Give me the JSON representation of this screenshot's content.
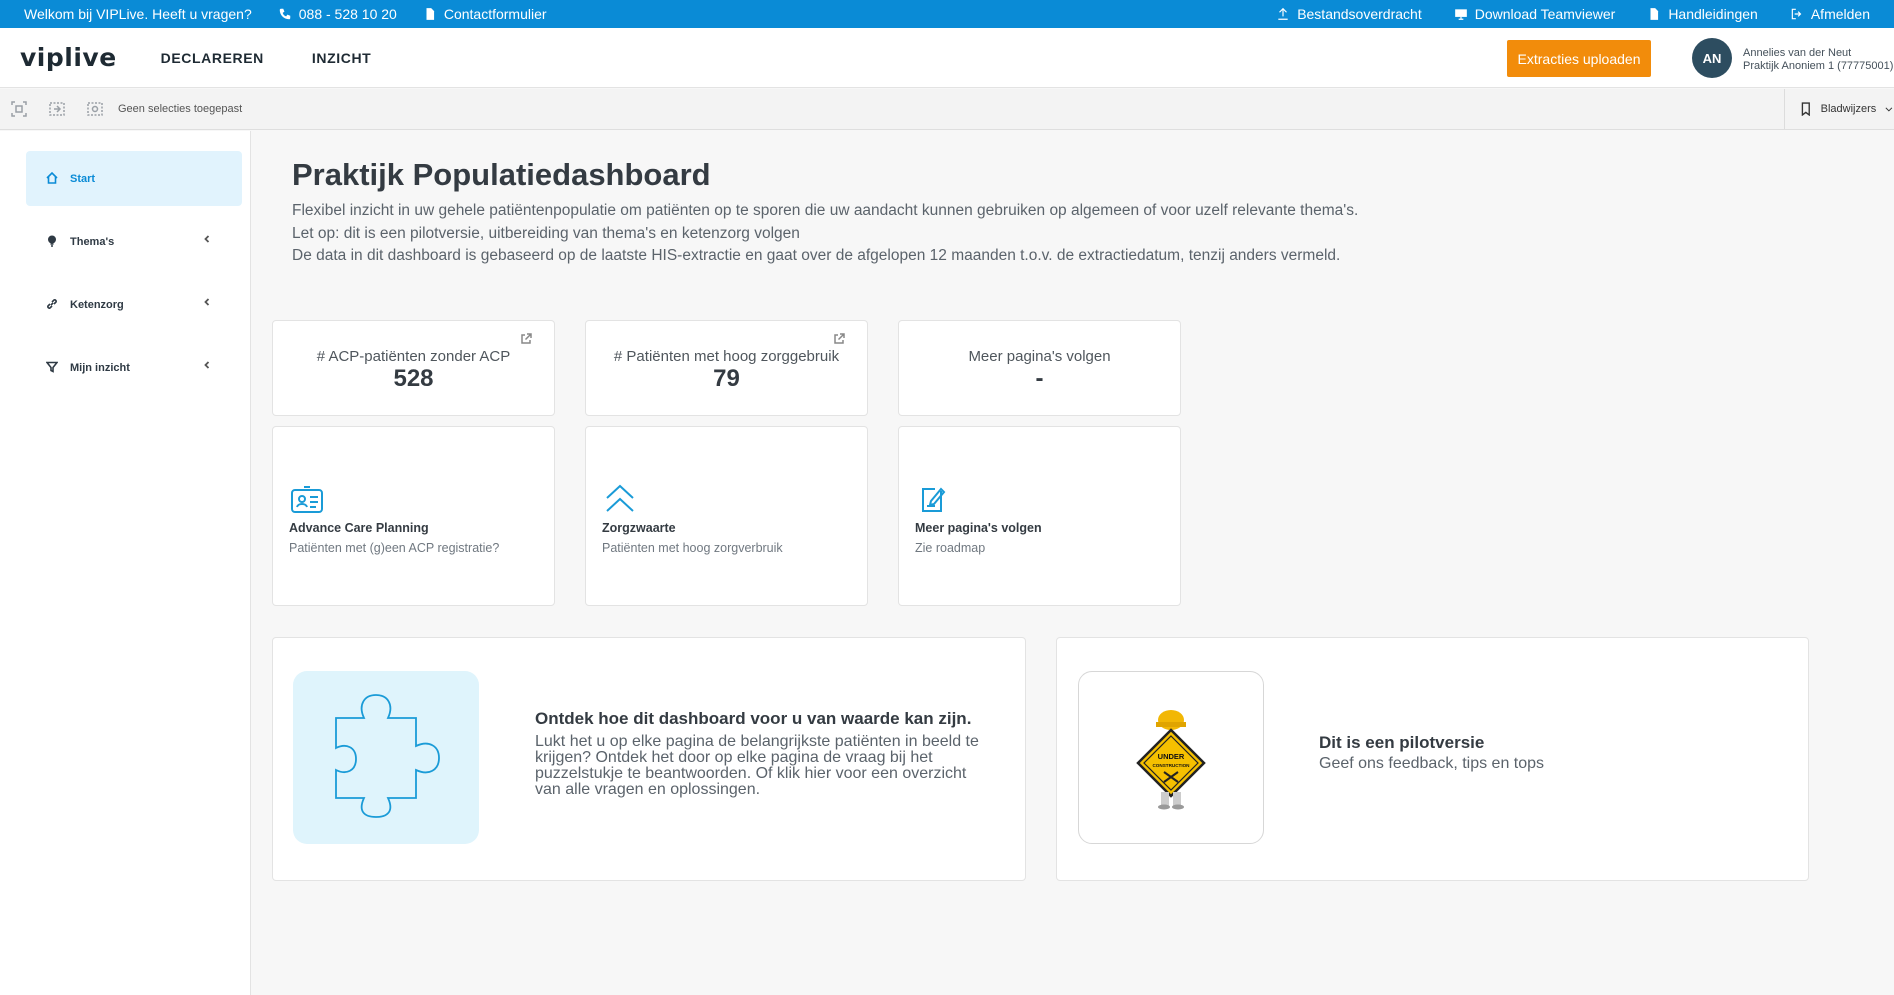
{
  "topbar": {
    "welcome": "Welkom bij VIPLive. Heeft u vragen?",
    "phone": "088 - 528 10 20",
    "contact": "Contactformulier",
    "file_transfer": "Bestandsoverdracht",
    "download_teamviewer": "Download Teamviewer",
    "manuals": "Handleidingen",
    "logout": "Afmelden"
  },
  "header": {
    "logo": "viplive",
    "nav": [
      "DECLAREREN",
      "INZICHT"
    ],
    "upload_button": "Extracties uploaden",
    "user_initials": "AN",
    "user_name": "Annelies van der Neut",
    "practice": "Praktijk Anoniem 1 (77775001)"
  },
  "selections": {
    "status": "Geen selecties toegepast",
    "bookmarks": "Bladwijzers"
  },
  "sidebar": {
    "items": [
      {
        "label": "Start",
        "icon": "home-icon",
        "active": true
      },
      {
        "label": "Thema's",
        "icon": "lightbulb-icon"
      },
      {
        "label": "Ketenzorg",
        "icon": "link-icon"
      },
      {
        "label": "Mijn inzicht",
        "icon": "filter-icon"
      }
    ]
  },
  "main": {
    "title": "Praktijk Populatiedashboard",
    "intro": [
      "Flexibel inzicht in uw gehele patiëntenpopulatie om patiënten op te sporen die uw aandacht kunnen gebruiken op algemeen of voor uzelf relevante thema's.",
      "Let op: dit is een pilotversie, uitbereiding van thema's en ketenzorg volgen",
      "De data in dit dashboard is gebaseerd op de laatste HIS-extractie en gaat over de afgelopen 12 maanden t.o.v. de extractiedatum, tenzij anders vermeld."
    ],
    "kpis": [
      {
        "label": "# ACP-patiënten zonder ACP",
        "value": "528"
      },
      {
        "label": "# Patiënten met hoog zorggebruik",
        "value": "79"
      },
      {
        "label": "Meer pagina's volgen",
        "value": "-"
      }
    ],
    "tiles": [
      {
        "title": "Advance Care Planning",
        "subtitle": "Patiënten met (g)een ACP registratie?",
        "icon": "id-card-icon"
      },
      {
        "title": "Zorgzwaarte",
        "subtitle": "Patiënten met hoog zorgverbruik",
        "icon": "double-chevron-up-icon"
      },
      {
        "title": "Meer pagina's volgen",
        "subtitle": "Zie roadmap",
        "icon": "edit-note-icon"
      }
    ],
    "info_card": {
      "title": "Ontdek hoe dit dashboard voor u van waarde kan zijn.",
      "text": "Lukt het u op elke pagina de belangrijkste patiënten in beeld te krijgen? Ontdek het door op elke pagina de vraag bij het puzzelstukje te beantwoorden. Of klik hier voor een overzicht van alle vragen en oplossingen."
    },
    "pilot_card": {
      "title": "Dit is een pilotversie",
      "text": "Geef ons feedback, tips en tops",
      "sign_text": "UNDER CONSTRUCTION"
    }
  },
  "colors": {
    "topbar": "#0a8bd6",
    "accent": "#1a9bd7",
    "upload_button": "#f28c0b",
    "avatar": "#2d4d60",
    "active_sidebar": "#e1f3fd"
  }
}
